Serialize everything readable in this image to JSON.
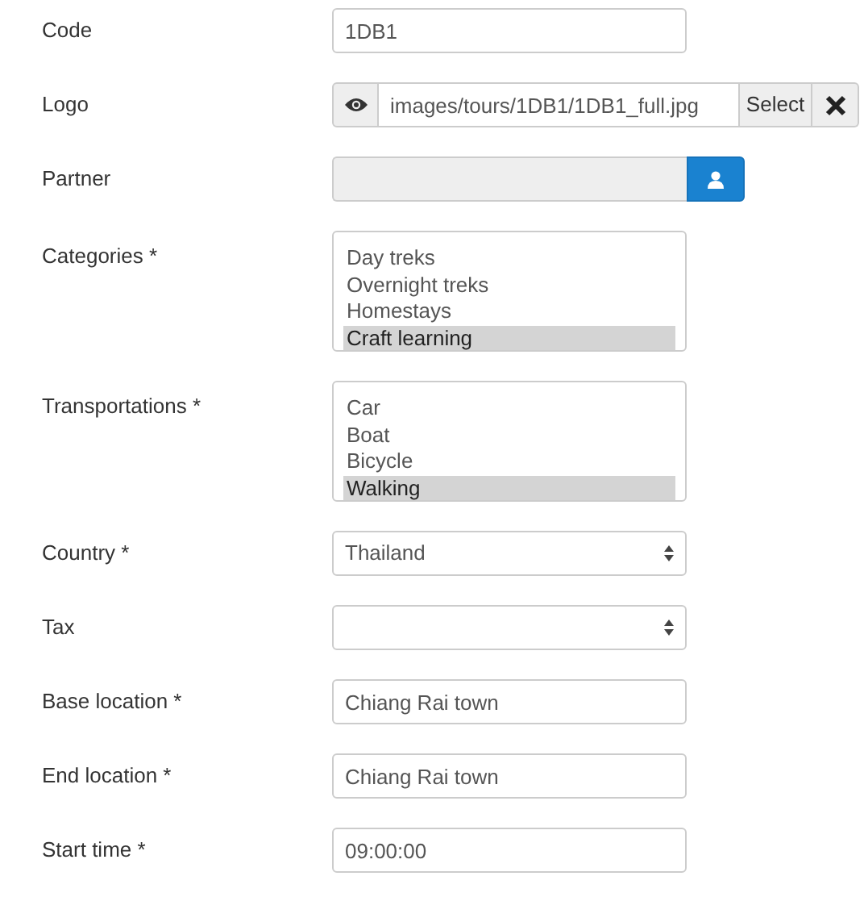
{
  "fields": [
    {
      "kind": "text",
      "label": "Code",
      "value": "1DB1"
    },
    {
      "kind": "media",
      "label": "Logo",
      "value": "images/tours/1DB1/1DB1_full.jpg",
      "select_button": "Select"
    },
    {
      "kind": "partner",
      "label": "Partner"
    },
    {
      "kind": "listbox",
      "label": "Categories *",
      "options": [
        {
          "text": "Day treks",
          "selected": false
        },
        {
          "text": "Overnight treks",
          "selected": false
        },
        {
          "text": "Homestays",
          "selected": false
        },
        {
          "text": "Craft learning",
          "selected": true
        }
      ]
    },
    {
      "kind": "listbox",
      "label": "Transportations *",
      "options": [
        {
          "text": "Car",
          "selected": false
        },
        {
          "text": "Boat",
          "selected": false
        },
        {
          "text": "Bicycle",
          "selected": false
        },
        {
          "text": "Walking",
          "selected": true
        }
      ]
    },
    {
      "kind": "select",
      "label": "Country *",
      "value": "Thailand"
    },
    {
      "kind": "select",
      "label": "Tax"
    },
    {
      "kind": "text",
      "label": "Base location *",
      "value": "Chiang Rai town"
    },
    {
      "kind": "text",
      "label": "End location *",
      "value": "Chiang Rai town"
    },
    {
      "kind": "text",
      "label": "Start time *",
      "value": "09:00:00"
    }
  ]
}
